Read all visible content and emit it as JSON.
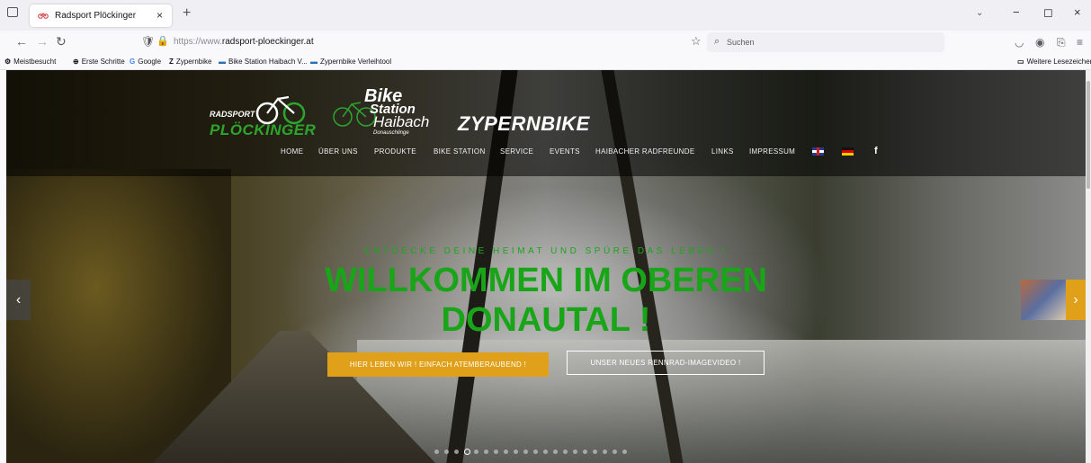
{
  "browser": {
    "tab": {
      "title": "Radsport Plöckinger",
      "close": "×"
    },
    "new_tab": "+",
    "list_all_tabs": "⌄",
    "window": {
      "minimize": "−",
      "maximize": "◻",
      "close": "×"
    },
    "nav": {
      "back": "←",
      "forward": "→",
      "reload": "↻"
    },
    "url": {
      "prefix": "https://www.",
      "domain": "radsport-ploeckinger.at"
    },
    "search": {
      "placeholder": "Suchen"
    },
    "bookmarks": [
      {
        "icon": "⚙",
        "label": "Meistbesucht"
      },
      {
        "icon": "⊕",
        "label": "Erste Schritte"
      },
      {
        "icon": "G",
        "label": "Google"
      },
      {
        "icon": "Z",
        "label": "Zypernbike"
      },
      {
        "icon": "▬",
        "label": "Bike Station Haibach V..."
      },
      {
        "icon": "▬",
        "label": "Zypernbike Verleihtool"
      }
    ],
    "other_bookmarks": "Weitere Lesezeichen"
  },
  "site": {
    "logos": {
      "radsport_top": "RADSPORT",
      "radsport_name": "PLÖCKINGER",
      "bike_station_1": "Bike",
      "bike_station_2": "Station",
      "bike_station_3": "Haibach",
      "bike_station_4": "Donauschlinge",
      "zypernbike": "ZYPERNBIKE"
    },
    "menu": [
      "HOME",
      "ÜBER UNS",
      "PRODUKTE",
      "BIKE STATION",
      "SERVICE",
      "EVENTS",
      "HAIBACHER RADFREUNDE",
      "LINKS",
      "IMPRESSUM"
    ],
    "facebook": "f",
    "hero": {
      "eyebrow": "ENTDECKE DEINE HEIMAT UND SPÜRE DAS LEBEN !",
      "headline_line1": "WILLKOMMEN IM OBEREN",
      "headline_line2": "DONAUTAL !",
      "button_primary": "HIER LEBEN WIR ! EINFACH ATEMBERAUBEND !",
      "button_secondary": "UNSER NEUES RENNRAD-IMAGEVIDEO !",
      "prev": "‹",
      "next": "›",
      "slide_count": 20,
      "active_slide": 3
    },
    "colors": {
      "accent_green": "#18a518",
      "accent_orange": "#e1a019"
    }
  }
}
